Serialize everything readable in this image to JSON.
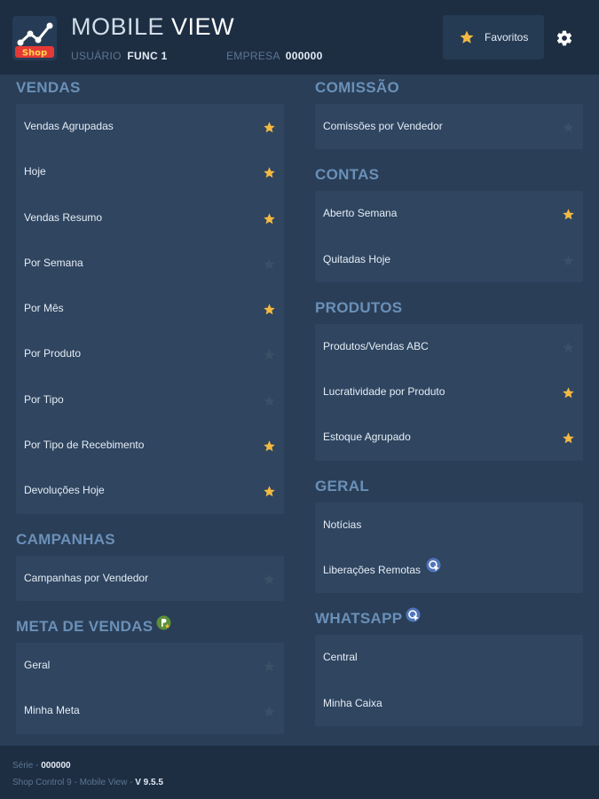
{
  "colors": {
    "accent": "#f4b942",
    "star_off": "#3b4f67",
    "section": "#6a90b8",
    "bg": "#2a3e57",
    "header": "#1d2e43",
    "card": "#2f4560"
  },
  "header": {
    "logo_text": "Shop",
    "title_light": "MOBILE",
    "title_bold": "VIEW",
    "user_label": "USUÁRIO",
    "user_value": "FUNC 1",
    "company_label": "EMPRESA",
    "company_value": "000000",
    "favorites_label": "Favoritos",
    "favorites_icon": "star-icon",
    "settings_icon": "gear-icon"
  },
  "left_sections": [
    {
      "title": "VENDAS",
      "items": [
        {
          "label": "Vendas Agrupadas",
          "fav": true
        },
        {
          "label": "Hoje",
          "fav": true
        },
        {
          "label": "Vendas Resumo",
          "fav": true
        },
        {
          "label": "Por Semana",
          "fav": false
        },
        {
          "label": "Por Mês",
          "fav": true
        },
        {
          "label": "Por Produto",
          "fav": false
        },
        {
          "label": "Por Tipo",
          "fav": false
        },
        {
          "label": "Por Tipo de Recebimento",
          "fav": true
        },
        {
          "label": "Devoluções Hoje",
          "fav": true
        }
      ]
    },
    {
      "title": "CAMPANHAS",
      "items": [
        {
          "label": "Campanhas por Vendedor",
          "fav": false
        }
      ]
    },
    {
      "title": "META DE VENDAS",
      "items": [
        {
          "label": "Geral",
          "fav": false
        },
        {
          "label": "Minha Meta",
          "fav": false
        }
      ]
    }
  ],
  "right_sections": [
    {
      "title": "COMISSÃO",
      "items": [
        {
          "label": "Comissões por Vendedor",
          "fav": false
        }
      ]
    },
    {
      "title": "CONTAS",
      "items": [
        {
          "label": "Aberto Semana",
          "fav": true
        },
        {
          "label": "Quitadas Hoje",
          "fav": false
        }
      ]
    },
    {
      "title": "PRODUTOS",
      "items": [
        {
          "label": "Produtos/Vendas ABC",
          "fav": false
        },
        {
          "label": "Lucratividade por Produto",
          "fav": true
        },
        {
          "label": "Estoque Agrupado",
          "fav": true
        }
      ]
    },
    {
      "title": "GERAL",
      "items": [
        {
          "label": "Notícias"
        },
        {
          "label": "Liberações Remotas"
        }
      ]
    },
    {
      "title": "WHATSAPP",
      "items": [
        {
          "label": "Central"
        },
        {
          "label": "Minha Caixa"
        }
      ]
    }
  ],
  "footer": {
    "serie_label": "Série -",
    "serie_value": "000000",
    "app_label": "Shop Control 9 - Mobile View -",
    "version": "V 9.5.5"
  }
}
